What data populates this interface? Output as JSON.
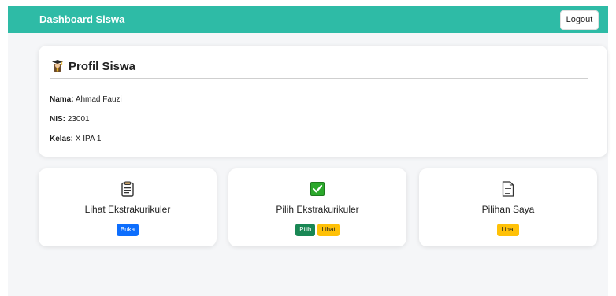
{
  "navbar": {
    "brand": "Dashboard Siswa",
    "logout_label": "Logout",
    "color": "#2ebba6"
  },
  "profile": {
    "icon": "student-graduate-icon",
    "title": "Profil Siswa",
    "fields": [
      {
        "label": "Nama:",
        "value": "Ahmad Fauzi"
      },
      {
        "label": "NIS:",
        "value": "23001"
      },
      {
        "label": "Kelas:",
        "value": "X IPA 1"
      }
    ]
  },
  "menu": [
    {
      "icon": "clipboard-icon",
      "title": "Lihat Ekstrakurikuler",
      "buttons": [
        {
          "label": "Buka",
          "color": "#0d6efd"
        }
      ]
    },
    {
      "icon": "check-mark-icon",
      "title": "Pilih Ekstrakurikuler",
      "buttons": [
        {
          "label": "Pilih",
          "color": "#198754"
        },
        {
          "label": "Lihat",
          "color": "#ffc107"
        }
      ]
    },
    {
      "icon": "document-icon",
      "title": "Pilihan Saya",
      "buttons": [
        {
          "label": "Lihat",
          "color": "#ffc107"
        }
      ]
    }
  ]
}
